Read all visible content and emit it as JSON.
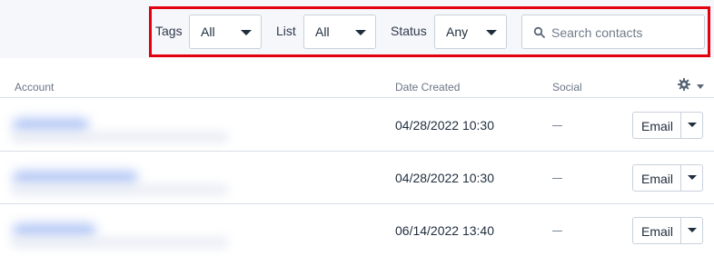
{
  "filters": {
    "tags": {
      "label": "Tags",
      "value": "All"
    },
    "list": {
      "label": "List",
      "value": "All"
    },
    "status": {
      "label": "Status",
      "value": "Any"
    },
    "search": {
      "placeholder": "Search contacts",
      "value": ""
    }
  },
  "highlight_color": "#e3000f",
  "table": {
    "columns": {
      "account": "Account",
      "date_created": "Date Created",
      "social": "Social"
    },
    "settings_icon": "gear-icon",
    "rows": [
      {
        "account": "",
        "date_created": "04/28/2022 10:30",
        "social": "—",
        "action": "Email"
      },
      {
        "account": "",
        "date_created": "04/28/2022 10:30",
        "social": "—",
        "action": "Email"
      },
      {
        "account": "",
        "date_created": "06/14/2022 13:40",
        "social": "—",
        "action": "Email"
      }
    ]
  }
}
